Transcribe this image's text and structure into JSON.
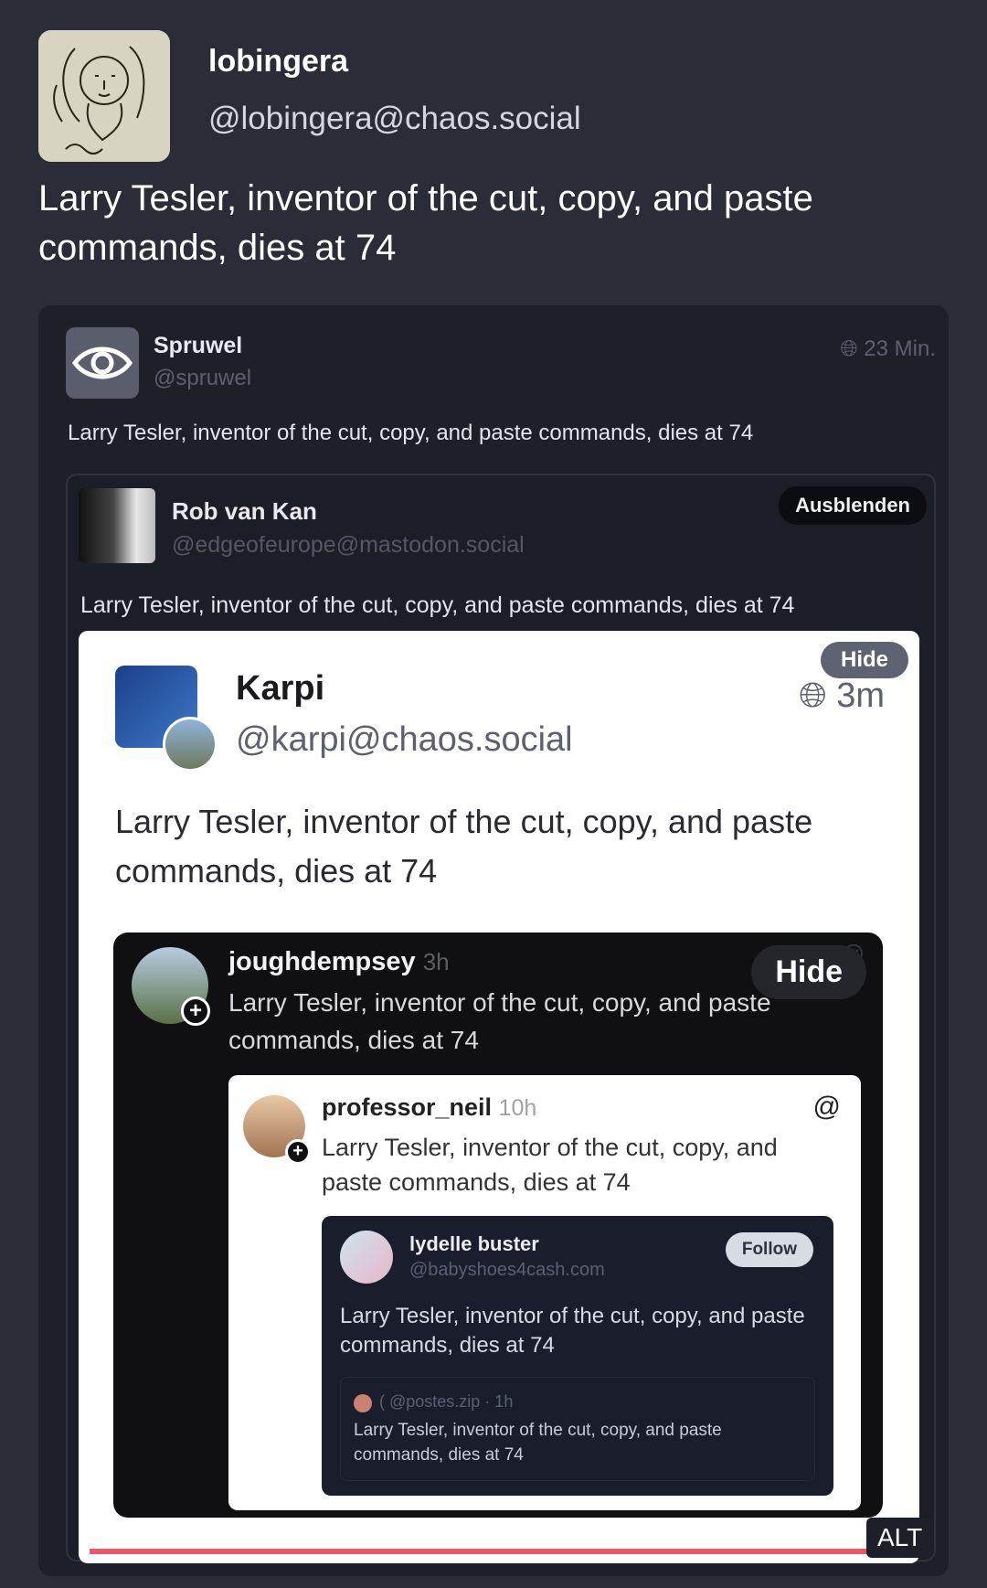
{
  "outer_post": {
    "display_name": "lobingera",
    "handle": "@lobingera@chaos.social",
    "text": "Larry Tesler, inventor of the cut, copy, and paste commands, dies at 74"
  },
  "image": {
    "alt_badge": "ALT",
    "level1": {
      "display_name": "Spruwel",
      "handle": "@spruwel",
      "time": "23 Min.",
      "text": "Larry Tesler, inventor of the cut, copy, and paste commands, dies at 74"
    },
    "level2": {
      "display_name": "Rob van Kan",
      "handle": "@edgeofeurope@mastodon.social",
      "button": "Ausblenden",
      "text": "Larry Tesler, inventor of the cut, copy, and paste commands, dies at 74"
    },
    "level3": {
      "display_name": "Karpi",
      "handle": "@karpi@chaos.social",
      "time": "3m",
      "button": "Hide",
      "text": "Larry Tesler, inventor of the cut, copy, and paste commands, dies at 74"
    },
    "level4": {
      "username": "joughdempsey",
      "time": "3h",
      "button": "Hide",
      "text": "Larry Tesler, inventor of the cut, copy, and paste commands, dies at 74"
    },
    "level5": {
      "username": "professor_neil",
      "time": "10h",
      "text": "Larry Tesler, inventor of the cut, copy, and paste commands, dies at 74"
    },
    "level6": {
      "display_name": "lydelle buster",
      "handle": "@babyshoes4cash.com",
      "button": "Follow",
      "text": "Larry Tesler, inventor of the cut, copy, and paste commands, dies at 74"
    },
    "level7": {
      "meta": "( @postes.zip · 1h",
      "text": "Larry Tesler, inventor of the cut, copy, and paste commands, dies at 74"
    }
  }
}
